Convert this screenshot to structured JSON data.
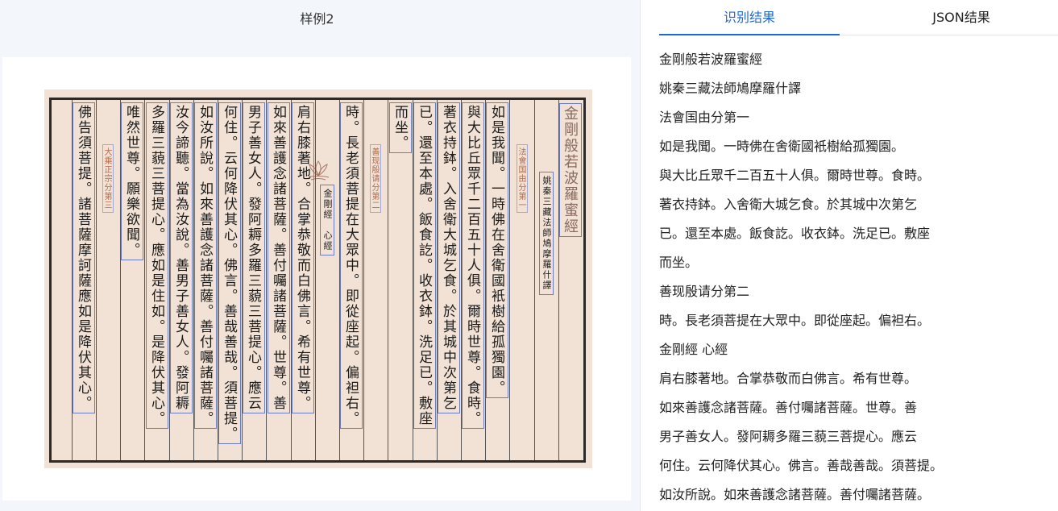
{
  "sample": {
    "title": "样例2"
  },
  "tabs": [
    {
      "label": "识别结果"
    },
    {
      "label": "JSON结果"
    }
  ],
  "results": [
    "金剛般若波羅蜜經",
    "姚秦三藏法師鳩摩羅什譯",
    "法會国由分第一",
    "如是我聞。一時佛在舍衛國衹樹給孤獨園。",
    "與大比丘眾千二百五十人俱。爾時世尊。食時。",
    "著衣持鉢。入舍衛大城乞食。於其城中次第乞",
    "已。還至本處。飯食訖。收衣鉢。洗足已。敷座",
    "而坐。",
    "善现殷请分第二",
    "時。長老須菩提在大眾中。即從座起。偏袒右。",
    "金剛經 心經",
    "肩右膝著地。合掌恭敬而白佛言。希有世尊。",
    "如來善護念諸菩薩。善付囑諸菩薩。世尊。善",
    "男子善女人。發阿耨多羅三藐三菩提心。應云",
    "何住。云何降伏其心。佛言。善哉善哉。須菩提。",
    "如汝所說。如來善護念諸菩薩。善付囑諸菩薩。"
  ],
  "scroll": {
    "columns": [
      {
        "text": "金剛般若波羅蜜經",
        "kind": "title"
      },
      {
        "text": "姚秦三藏法師鳩摩羅什譯",
        "kind": "mid"
      },
      {
        "text": "法會国由分第一",
        "kind": "small"
      },
      {
        "text": "如是我聞。一時佛在舍衛國衹樹給孤獨園。",
        "kind": "main"
      },
      {
        "text": "與大比丘眾千二百五十人俱。爾時世尊。食時。",
        "kind": "main"
      },
      {
        "text": "著衣持鉢。入舍衛大城乞食。於其城中次第乞",
        "kind": "main"
      },
      {
        "text": "已。還至本處。飯食訖。收衣鉢。洗足已。敷座",
        "kind": "main"
      },
      {
        "text": "而坐。",
        "kind": "main"
      },
      {
        "text": "善现殷请分第二",
        "kind": "small"
      },
      {
        "text": "時。長老須菩提在大眾中。即從座起。偏袒右。",
        "kind": "main"
      },
      {
        "text": "金剛經　心經",
        "kind": "mid"
      },
      {
        "text": "肩右膝著地。合掌恭敬而白佛言。希有世尊。",
        "kind": "main"
      },
      {
        "text": "如來善護念諸菩薩。善付囑諸菩薩。世尊。善",
        "kind": "main"
      },
      {
        "text": "男子善女人。發阿耨多羅三藐三菩提心。應云",
        "kind": "main"
      },
      {
        "text": "何住。云何降伏其心。佛言。善哉善哉。須菩提。",
        "kind": "main"
      },
      {
        "text": "如汝所說。如來善護念諸菩薩。善付囑諸菩薩。",
        "kind": "main"
      },
      {
        "text": "汝今諦聽。當為汝說。善男子善女人。發阿耨",
        "kind": "main"
      },
      {
        "text": "多羅三藐三菩提心。應如是住如。是降伏其心。",
        "kind": "main"
      },
      {
        "text": "唯然世尊。願樂欲聞。",
        "kind": "main"
      },
      {
        "text": "大乘正宗分第三",
        "kind": "small"
      },
      {
        "text": "佛告須菩提。諸菩薩摩訶薩應如是降伏其心。",
        "kind": "main"
      }
    ]
  },
  "colors": {
    "accent": "#1c6ad8",
    "scroll_bg": "#f1e2d5"
  },
  "icons": {
    "ornament": "lotus-ornament-icon"
  }
}
